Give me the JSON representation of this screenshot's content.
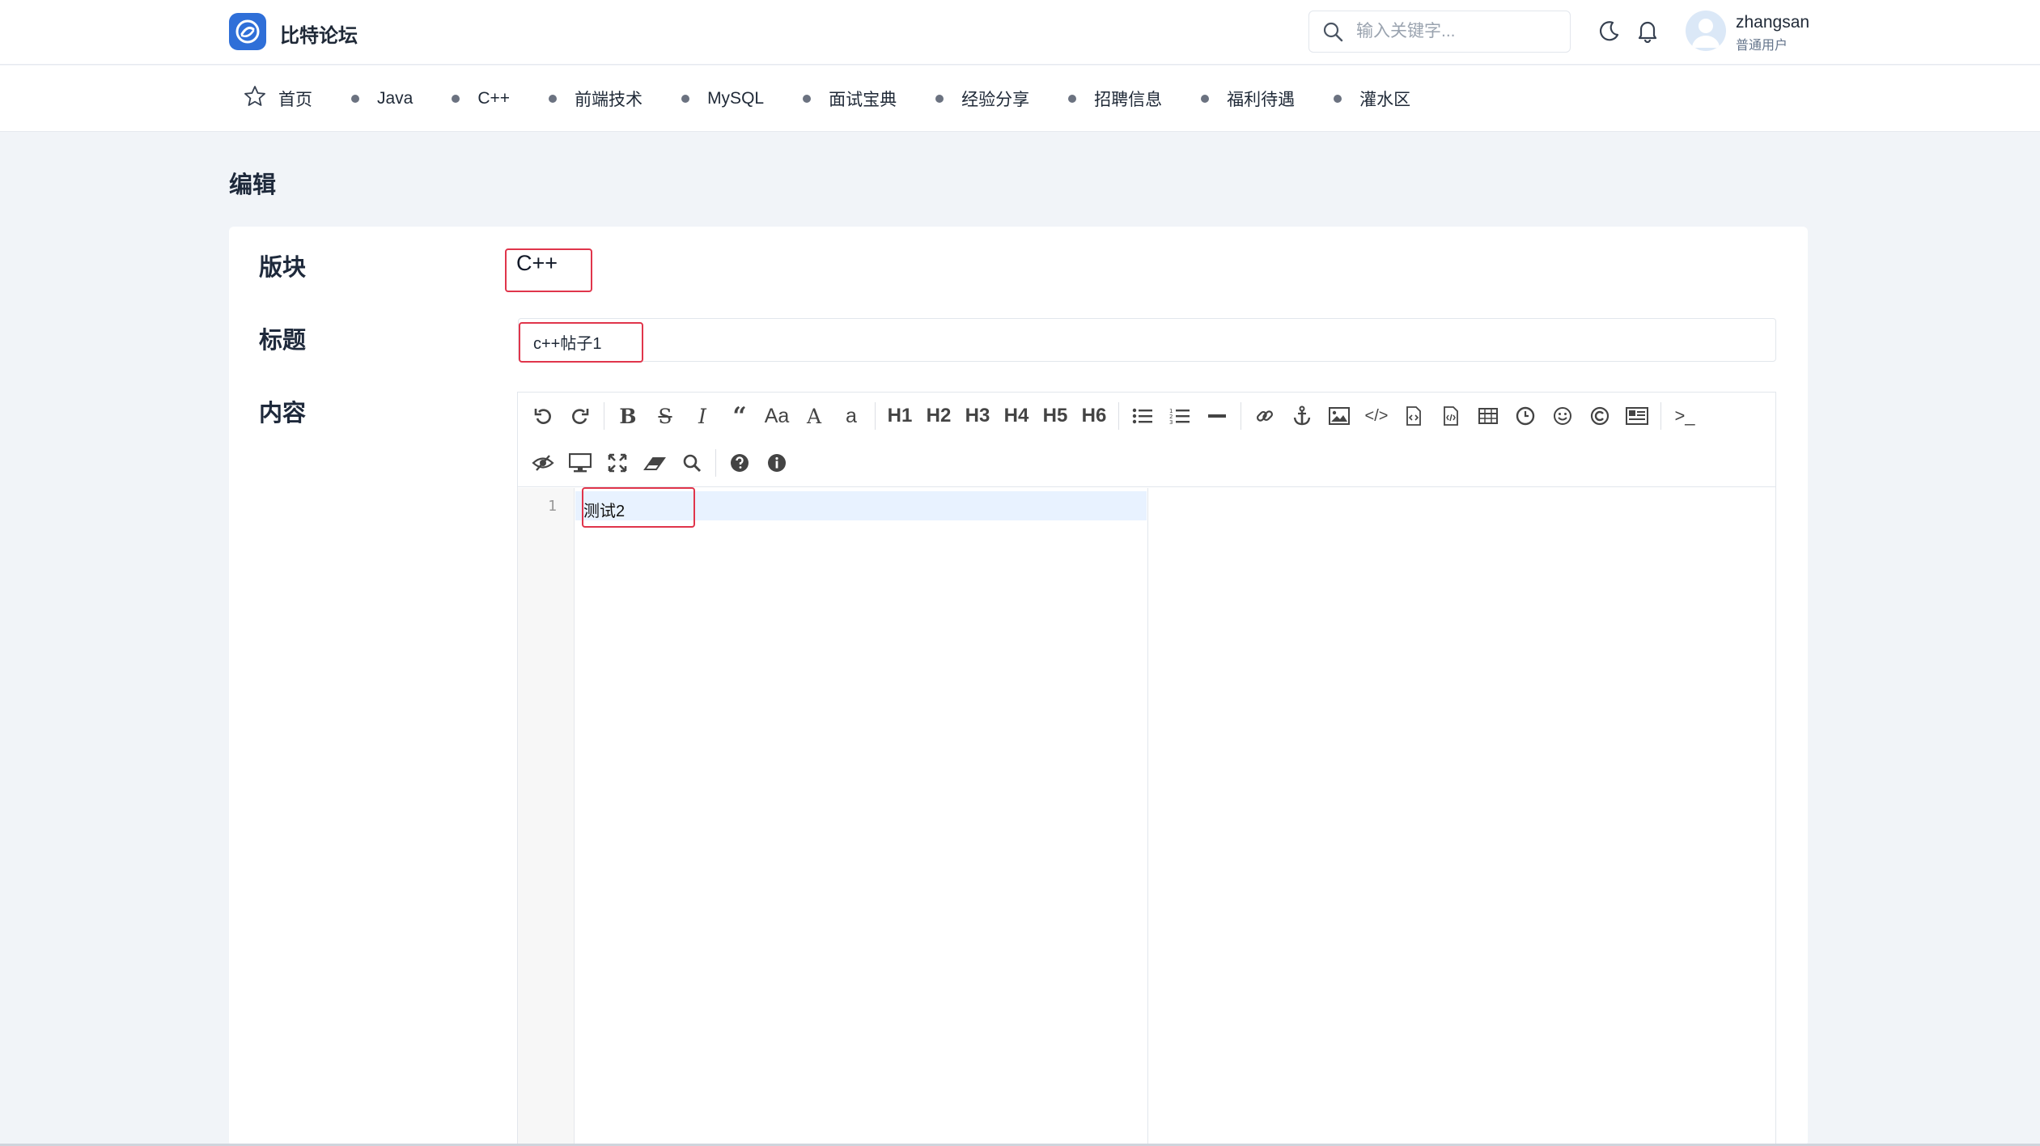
{
  "header": {
    "brand": "比特论坛",
    "search_placeholder": "输入关键字...",
    "user": {
      "name": "zhangsan",
      "role": "普通用户"
    }
  },
  "nav": [
    {
      "label": "首页",
      "icon": "star-icon"
    },
    {
      "label": "Java"
    },
    {
      "label": "C++"
    },
    {
      "label": "前端技术"
    },
    {
      "label": "MySQL"
    },
    {
      "label": "面试宝典"
    },
    {
      "label": "经验分享"
    },
    {
      "label": "招聘信息"
    },
    {
      "label": "福利待遇"
    },
    {
      "label": "灌水区"
    }
  ],
  "page": {
    "title": "编辑"
  },
  "form": {
    "board_label": "版块",
    "board_value": "C++",
    "title_label": "标题",
    "title_value": "c++帖子1",
    "content_label": "内容"
  },
  "editor": {
    "toolbar": {
      "case_upper": "Aa",
      "case_lower": "a",
      "headings": [
        "H1",
        "H2",
        "H3",
        "H4",
        "H5",
        "H6"
      ]
    },
    "line_number": "1",
    "content": "测试2"
  },
  "colors": {
    "accent": "#2f6fd8",
    "highlight": "#e0354b",
    "page_bg": "#f1f4f8"
  }
}
